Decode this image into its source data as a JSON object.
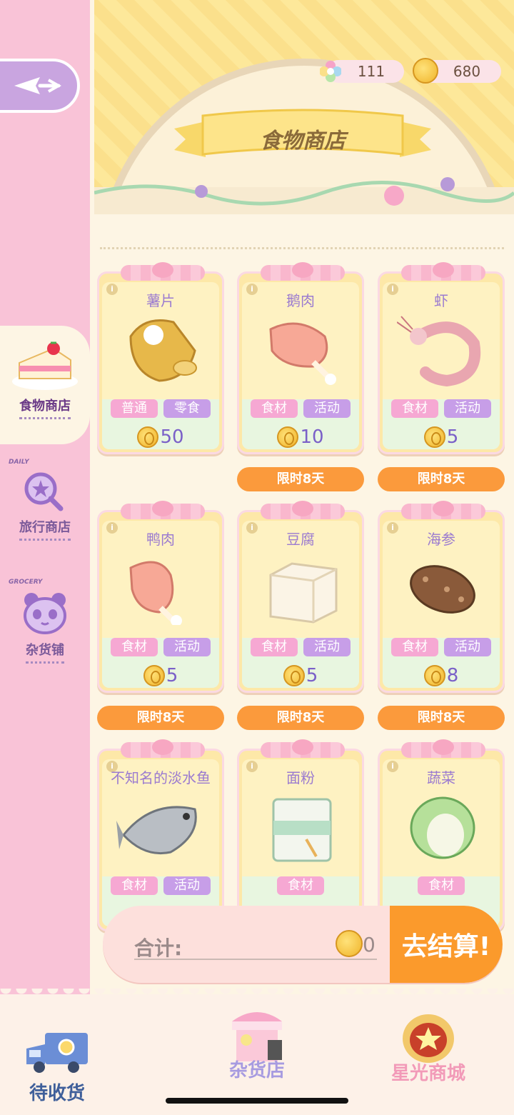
{
  "currency": {
    "gems": "111",
    "coins": "680"
  },
  "header": {
    "title": "食物商店"
  },
  "sidebar": {
    "items": [
      {
        "label": "食物商店",
        "tag": ""
      },
      {
        "label": "旅行商店",
        "tag": "DAILY"
      },
      {
        "label": "杂货铺",
        "tag": "GROCERY"
      }
    ]
  },
  "items": [
    {
      "name": "薯片",
      "tags": [
        "普通",
        "零食"
      ],
      "price": "50",
      "limit": ""
    },
    {
      "name": "鹅肉",
      "tags": [
        "食材",
        "活动"
      ],
      "price": "10",
      "limit": "限时8天"
    },
    {
      "name": "虾",
      "tags": [
        "食材",
        "活动"
      ],
      "price": "5",
      "limit": "限时8天"
    },
    {
      "name": "鸭肉",
      "tags": [
        "食材",
        "活动"
      ],
      "price": "5",
      "limit": "限时8天"
    },
    {
      "name": "豆腐",
      "tags": [
        "食材",
        "活动"
      ],
      "price": "5",
      "limit": "限时8天"
    },
    {
      "name": "海参",
      "tags": [
        "食材",
        "活动"
      ],
      "price": "8",
      "limit": "限时8天"
    },
    {
      "name": "不知名的淡水鱼",
      "tags": [
        "食材",
        "活动"
      ],
      "price": "",
      "limit": ""
    },
    {
      "name": "面粉",
      "tags": [
        "食材"
      ],
      "price": "",
      "limit": ""
    },
    {
      "name": "蔬菜",
      "tags": [
        "食材"
      ],
      "price": "",
      "limit": ""
    }
  ],
  "checkout": {
    "total_label": "合计:",
    "total_value": "0",
    "button": "去结算!"
  },
  "bottom_nav": {
    "pending": "待收货",
    "grocery": "杂货店",
    "starlight": "星光商城"
  }
}
